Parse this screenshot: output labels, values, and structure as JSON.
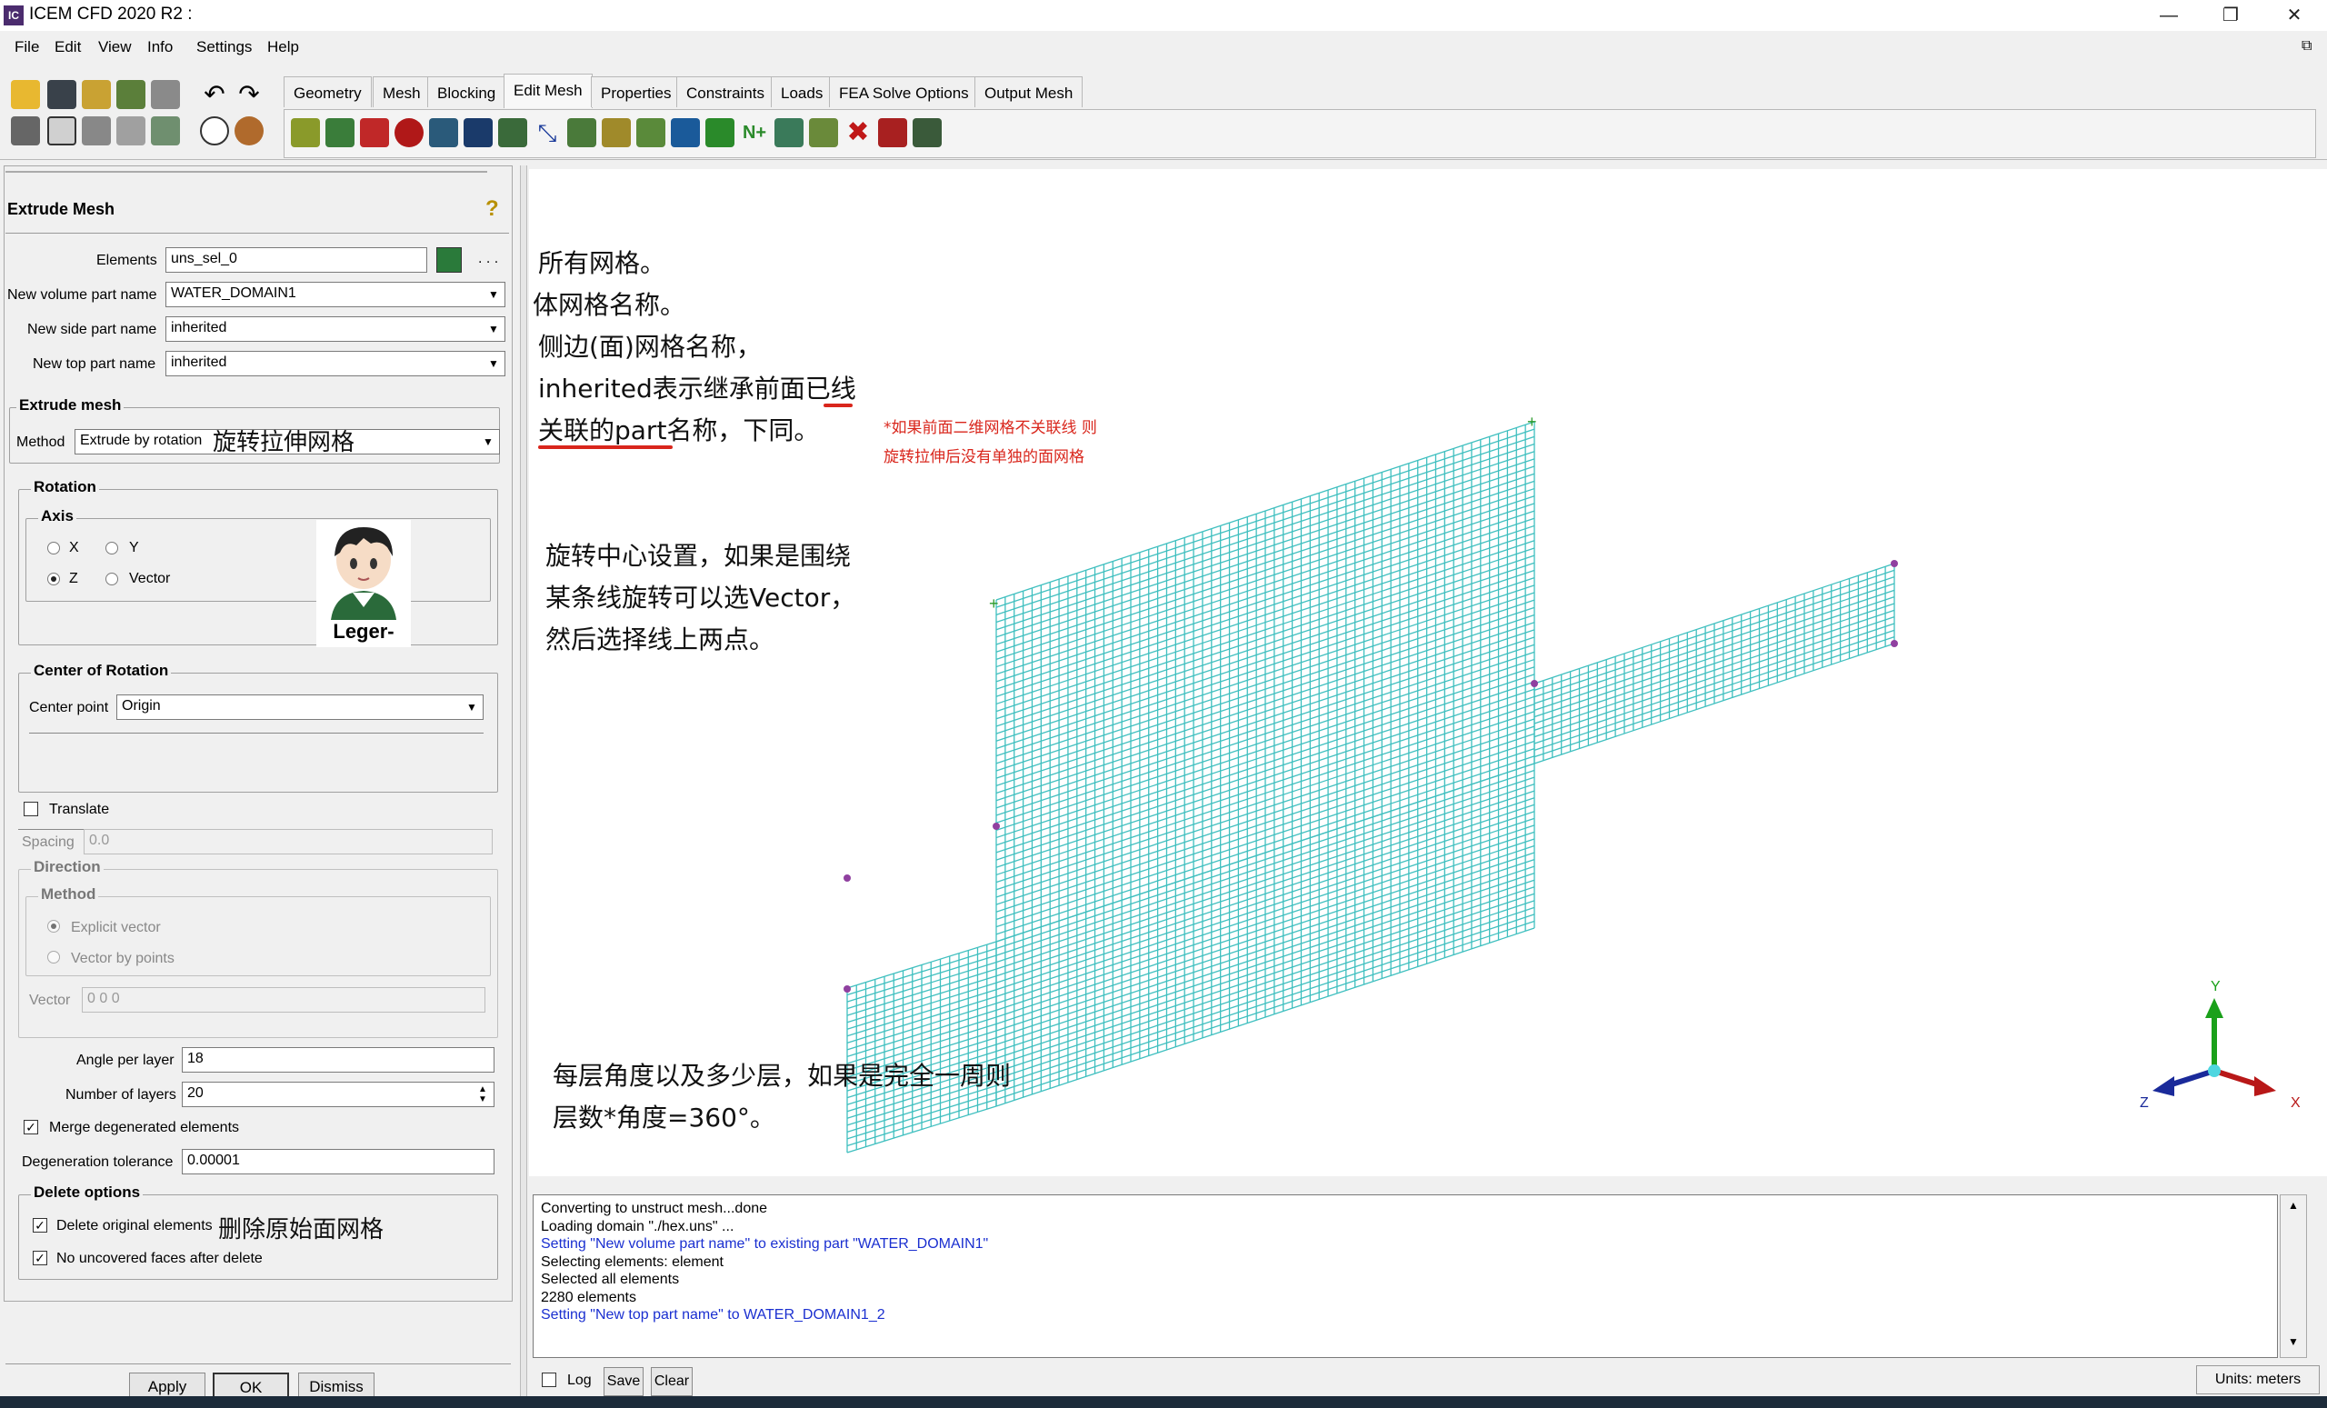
{
  "window": {
    "title": "ICEM CFD 2020 R2 :",
    "icon_label": "IC",
    "minimize": "—",
    "maximize": "❐",
    "close": "✕"
  },
  "menu": [
    "File",
    "Edit",
    "View",
    "Info",
    "Settings",
    "Help"
  ],
  "tabs": [
    "Geometry",
    "Mesh",
    "Blocking",
    "Edit Mesh",
    "Properties",
    "Constraints",
    "Loads",
    "FEA Solve Options",
    "Output Mesh"
  ],
  "active_tab": "Edit Mesh",
  "panel": {
    "title": "Extrude Mesh",
    "elements_label": "Elements",
    "elements_value": "uns_sel_0",
    "ellipsis": ". . .",
    "new_volume_label": "New volume part name",
    "new_volume_value": "WATER_DOMAIN1",
    "new_side_label": "New side part name",
    "new_side_value": "inherited",
    "new_top_label": "New top part name",
    "new_top_value": "inherited",
    "extrude_group": "Extrude mesh",
    "method_label": "Method",
    "method_value": "Extrude by rotation",
    "rotation_group": "Rotation",
    "axis_group": "Axis",
    "axis_x": "X",
    "axis_y": "Y",
    "axis_z": "Z",
    "axis_vector": "Vector",
    "avatar_label": "Leger-",
    "center_group": "Center of Rotation",
    "center_point_label": "Center point",
    "center_point_value": "Origin",
    "translate_label": "Translate",
    "spacing_label": "Spacing",
    "spacing_value": "0.0",
    "direction_group": "Direction",
    "method_sub_group": "Method",
    "explicit_vector": "Explicit vector",
    "vector_by_points": "Vector by points",
    "vector_label": "Vector",
    "vector_value": "0 0 0",
    "angle_label": "Angle per layer",
    "angle_value": "18",
    "layers_label": "Number of layers",
    "layers_value": "20",
    "merge_label": "Merge degenerated elements",
    "degen_tol_label": "Degeneration tolerance",
    "degen_tol_value": "0.00001",
    "delete_group": "Delete options",
    "delete_orig_label": "Delete original elements",
    "no_uncovered_label": "No uncovered faces after delete",
    "apply": "Apply",
    "ok": "OK",
    "dismiss": "Dismiss"
  },
  "annotations": {
    "method_note": "旋转拉伸网格",
    "delete_note": "删除原始面网格",
    "a1": "所有网格。",
    "a2": "体网格名称。",
    "a3": "侧边(面)网格名称，",
    "a4": "inherited表示继承前面已线",
    "a5": "关联的part名称，下同。",
    "red1": "*如果前面二维网格不关联线 则",
    "red2": "旋转拉伸后没有单独的面网格",
    "b1": "旋转中心设置，如果是围绕",
    "b2": "某条线旋转可以选Vector，",
    "b3": "然后选择线上两点。",
    "c1": "每层角度以及多少层，如果是完全一周则",
    "c2": "层数*角度=360°。"
  },
  "axes": {
    "x": "X",
    "y": "Y",
    "z": "Z"
  },
  "log": {
    "lines": [
      {
        "text": "Converting to unstruct mesh...done",
        "color": "#000000"
      },
      {
        "text": "Loading domain \"./hex.uns\" ...",
        "color": "#000000"
      },
      {
        "text": "Setting \"New volume part name\" to existing part \"WATER_DOMAIN1\"",
        "color": "#1a2fd0"
      },
      {
        "text": "Selecting elements: element",
        "color": "#000000"
      },
      {
        "text": "Selected all elements",
        "color": "#000000"
      },
      {
        "text": "2280 elements",
        "color": "#000000"
      },
      {
        "text": "Setting \"New top part name\" to WATER_DOMAIN1_2",
        "color": "#1a2fd0"
      }
    ],
    "log_label": "Log",
    "save": "Save",
    "clear": "Clear",
    "units": "Units: meters"
  },
  "colors": {
    "mesh": "#3fbfbf",
    "node": "#9040a0",
    "accent_red": "#d9261c"
  }
}
